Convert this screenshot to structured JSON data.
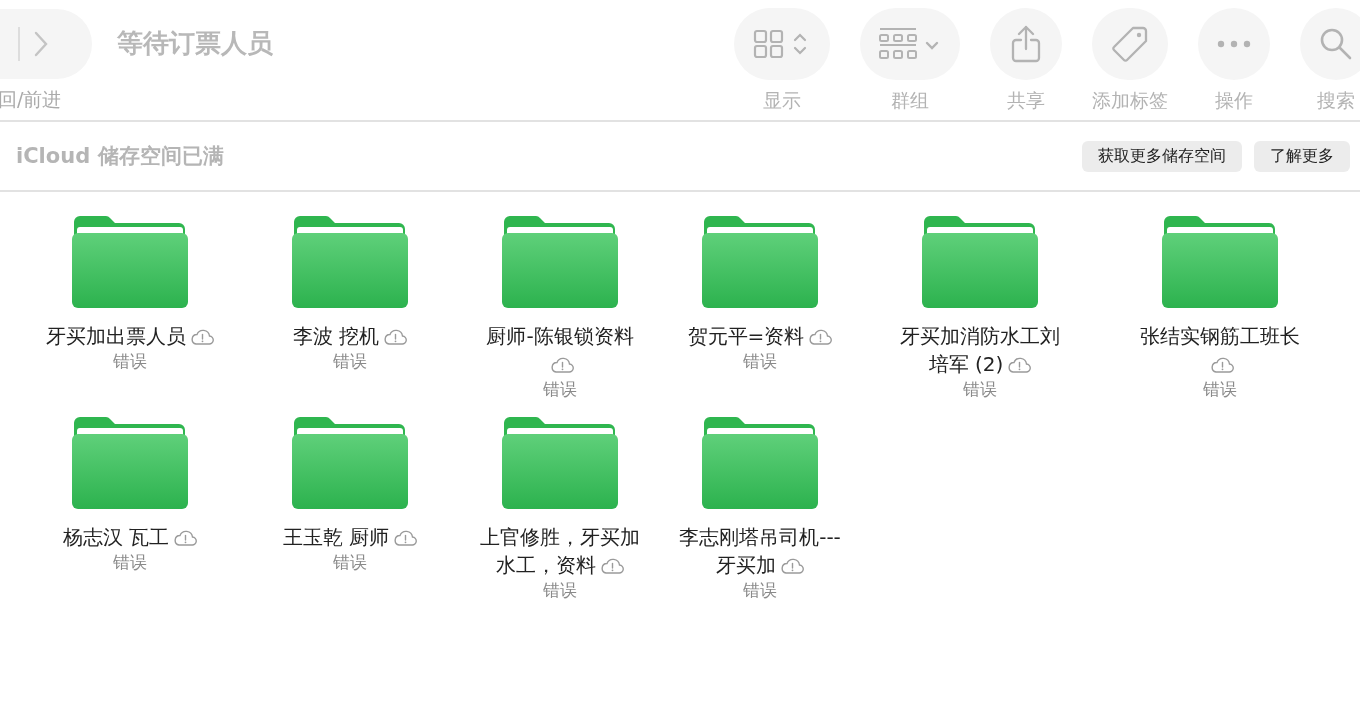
{
  "window": {
    "title": "等待订票人员"
  },
  "navigation": {
    "label": "回/前进"
  },
  "toolbar": [
    {
      "kind": "view",
      "label": "显示"
    },
    {
      "kind": "group",
      "label": "群组"
    },
    {
      "kind": "share",
      "label": "共享"
    },
    {
      "kind": "tag",
      "label": "添加标签"
    },
    {
      "kind": "more",
      "label": "操作"
    },
    {
      "kind": "search",
      "label": "搜索"
    }
  ],
  "banner": {
    "message": "iCloud 储存空间已满",
    "buttons": [
      "获取更多储存空间",
      "了解更多"
    ]
  },
  "folders": [
    {
      "name": "牙买加出票人员",
      "status": "错误"
    },
    {
      "name": "李波 挖机",
      "status": "错误"
    },
    {
      "name": "厨师-陈银锁资料",
      "status": "错误"
    },
    {
      "name": "贺元平=资料",
      "status": "错误"
    },
    {
      "name": "牙买加消防水工刘培军 (2)",
      "status": "错误"
    },
    {
      "name": "张结实钢筋工班长",
      "status": "错误"
    },
    {
      "name": "杨志汉  瓦工",
      "status": "错误"
    },
    {
      "name": "王玉乾  厨师",
      "status": "错误"
    },
    {
      "name": "上官修胜，牙买加水工，资料",
      "status": "错误"
    },
    {
      "name": "李志刚塔吊司机---牙买加",
      "status": "错误"
    }
  ]
}
